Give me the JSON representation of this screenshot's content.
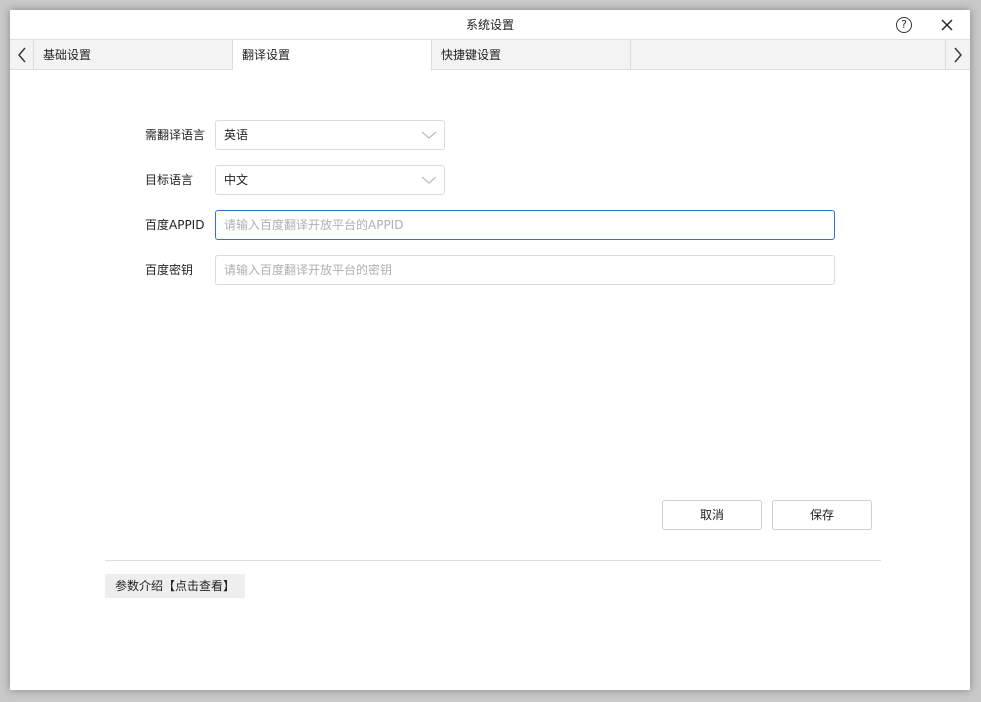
{
  "window": {
    "title": "系统设置"
  },
  "tabs": [
    {
      "label": "基础设置"
    },
    {
      "label": "翻译设置"
    },
    {
      "label": "快捷键设置"
    }
  ],
  "form": {
    "source_language": {
      "label": "需翻译语言",
      "value": "英语"
    },
    "target_language": {
      "label": "目标语言",
      "value": "中文"
    },
    "appid": {
      "label": "百度APPID",
      "value": "",
      "placeholder": "请输入百度翻译开放平台的APPID"
    },
    "secret_key": {
      "label": "百度密钥",
      "value": "",
      "placeholder": "请输入百度翻译开放平台的密钥"
    }
  },
  "buttons": {
    "cancel": "取消",
    "save": "保存"
  },
  "footer": {
    "info_link": "参数介绍【点击查看】"
  },
  "colors": {
    "focus_border": "#2f6fd6",
    "active_tab": "#ffffff",
    "tab_bar": "#f3f3f3"
  },
  "icons": [
    "help-icon",
    "close-icon",
    "chevron-left-icon",
    "chevron-right-icon",
    "chevron-down-icon"
  ]
}
